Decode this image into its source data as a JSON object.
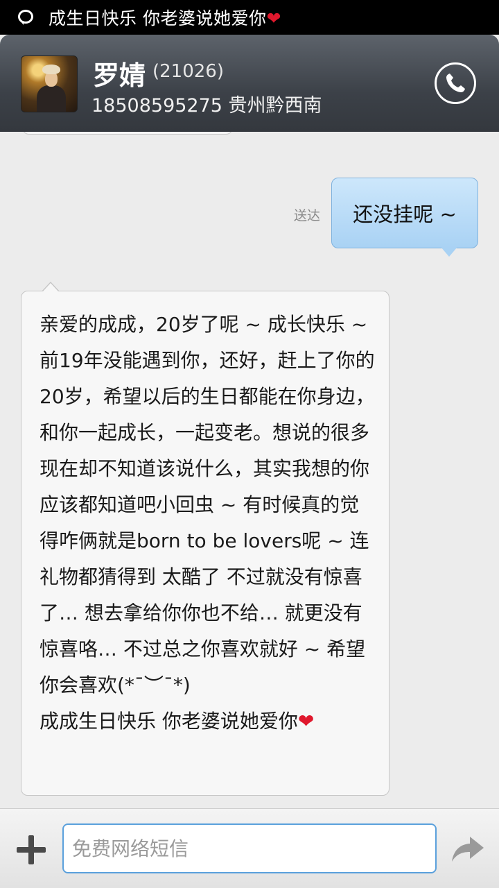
{
  "status_bar": {
    "notification_text": "成生日快乐 你老婆说她爱你",
    "heart": "❤"
  },
  "header": {
    "contact_name": "罗婧",
    "contact_id": "(21026)",
    "contact_info": "18508595275 贵州黔西南"
  },
  "messages": {
    "outgoing": {
      "status": "送达",
      "text": "还没挂呢 ~"
    },
    "incoming": {
      "text": "亲爱的成成，20岁了呢 ~ 成长快乐 ~ 前19年没能遇到你，还好，赶上了你的20岁，希望以后的生日都能在你身边，和你一起成长，一起变老。想说的很多现在却不知道该说什么，其实我想的你应该都知道吧小回虫 ~ 有时候真的觉得咋俩就是born to be lovers呢 ~ 连礼物都猜得到 太酷了 不过就没有惊喜了… 想去拿给你你也不给… 就更没有惊喜咯… 不过总之你喜欢就好 ~ 希望你会喜欢(*¯︶¯*)\n成成生日快乐 你老婆说她爱你",
      "heart": "❤"
    }
  },
  "composer": {
    "placeholder": "免费网络短信"
  },
  "colors": {
    "accent": "#5aa0dc",
    "outgoing_bubble": "#a9d2f4",
    "heart": "#e0182d"
  }
}
